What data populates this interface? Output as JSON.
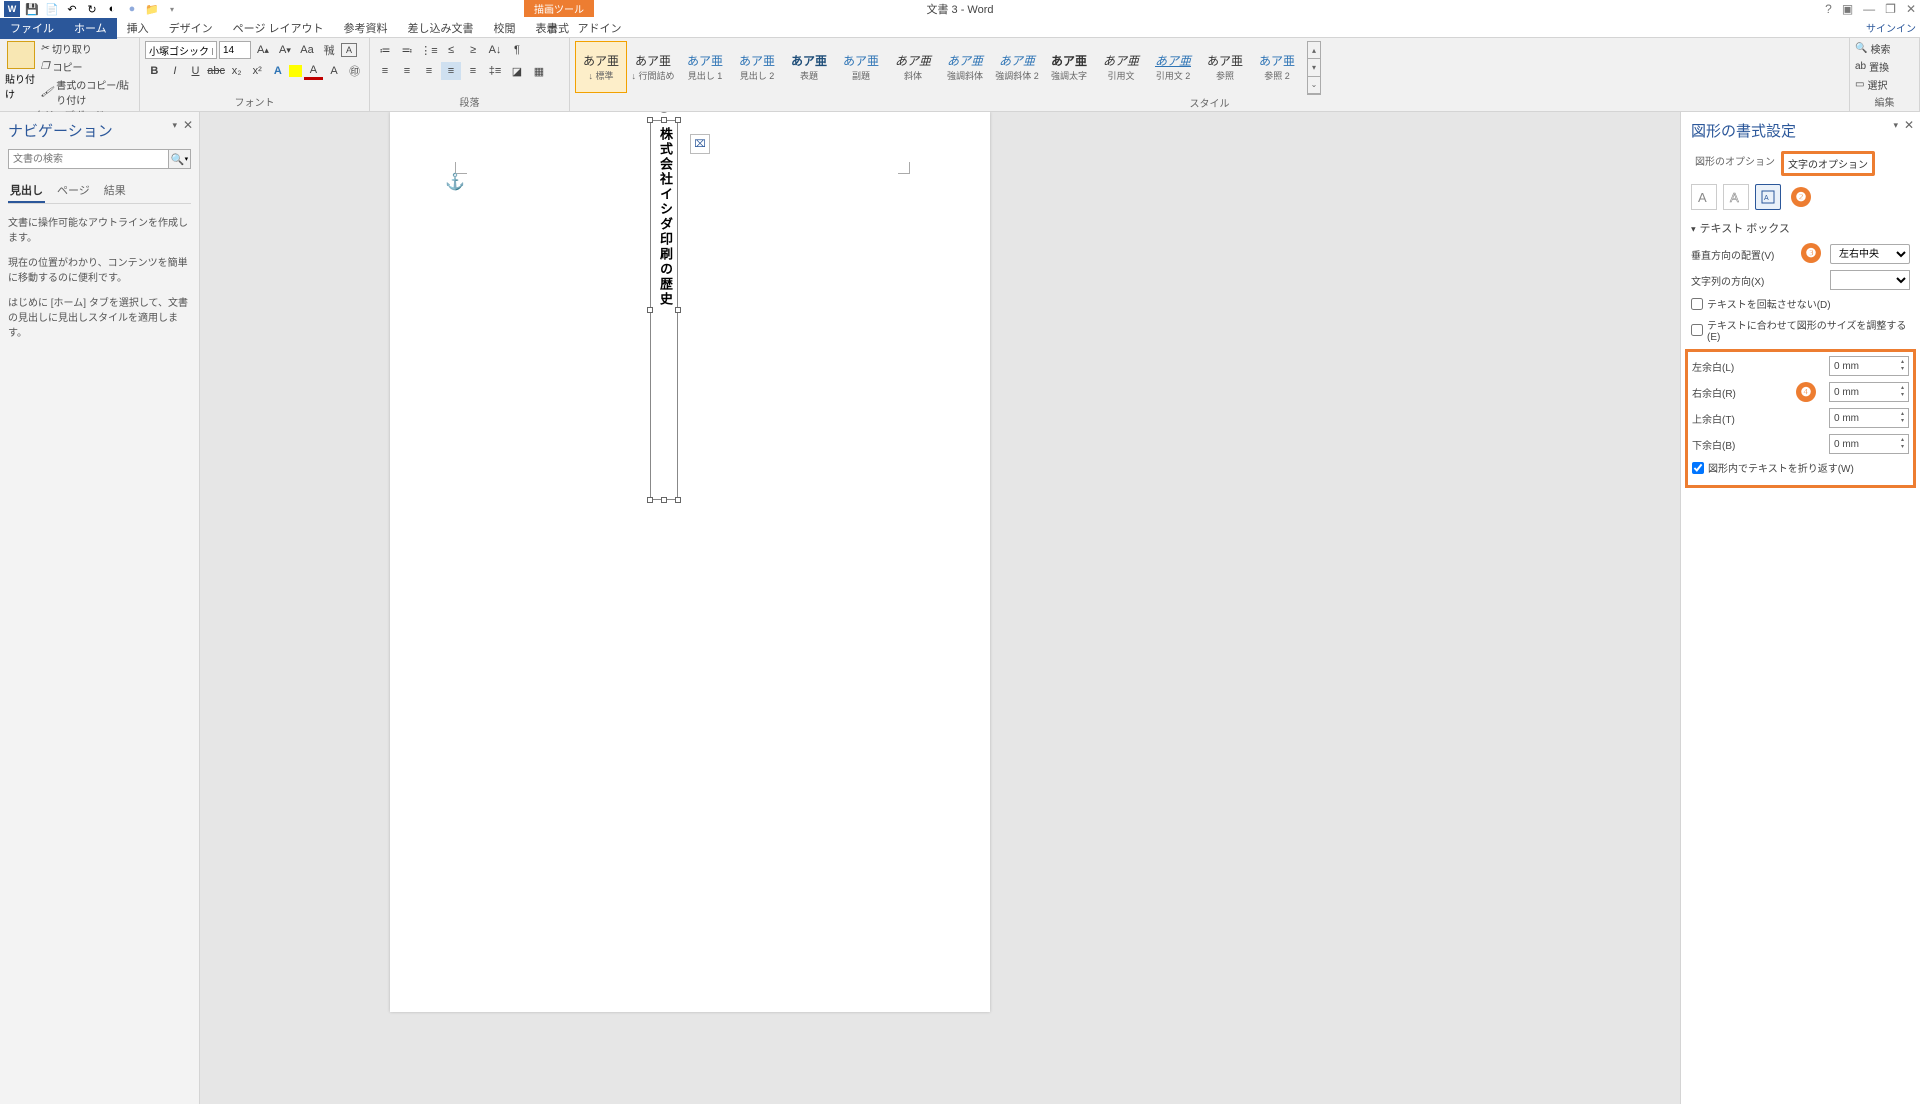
{
  "app": {
    "title": "文書 3 - Word",
    "context_tool": "描画ツール",
    "signin": "サインイン"
  },
  "qat": {
    "save": "保存",
    "undo": "元に戻す",
    "redo": "やり直し"
  },
  "tabs": {
    "file": "ファイル",
    "home": "ホーム",
    "insert": "挿入",
    "design": "デザイン",
    "layout": "ページ レイアウト",
    "references": "参考資料",
    "mailings": "差し込み文書",
    "review": "校閲",
    "view": "表示",
    "addin": "アドイン",
    "format": "書式"
  },
  "ribbon": {
    "clipboard": {
      "label": "クリップボード",
      "paste": "貼り付け",
      "cut": "切り取り",
      "copy": "コピー",
      "painter": "書式のコピー/貼り付け"
    },
    "font": {
      "label": "フォント",
      "name": "小塚ゴシック Pr",
      "size": "14"
    },
    "paragraph": {
      "label": "段落"
    },
    "styles": {
      "label": "スタイル",
      "items": [
        {
          "preview": "あア亜",
          "name": "↓ 標準",
          "cls": ""
        },
        {
          "preview": "あア亜",
          "name": "↓ 行間詰め",
          "cls": ""
        },
        {
          "preview": "あア亜",
          "name": "見出し 1",
          "cls": "blue"
        },
        {
          "preview": "あア亜",
          "name": "見出し 2",
          "cls": "blue"
        },
        {
          "preview": "あア亜",
          "name": "表題",
          "cls": "boldblue"
        },
        {
          "preview": "あア亜",
          "name": "副題",
          "cls": "blue"
        },
        {
          "preview": "あア亜",
          "name": "斜体",
          "cls": "italic"
        },
        {
          "preview": "あア亜",
          "name": "強調斜体",
          "cls": "italic blue"
        },
        {
          "preview": "あア亜",
          "name": "強調斜体 2",
          "cls": "italic blue"
        },
        {
          "preview": "あア亜",
          "name": "強調太字",
          "cls": "bold"
        },
        {
          "preview": "あア亜",
          "name": "引用文",
          "cls": "italic"
        },
        {
          "preview": "あア亜",
          "name": "引用文 2",
          "cls": "italic blue under"
        },
        {
          "preview": "あア亜",
          "name": "参照",
          "cls": ""
        },
        {
          "preview": "あア亜",
          "name": "参照 2",
          "cls": "blue"
        }
      ]
    },
    "editing": {
      "label": "編集",
      "find": "検索",
      "replace": "置換",
      "select": "選択"
    }
  },
  "nav": {
    "title": "ナビゲーション",
    "search_ph": "文書の検索",
    "tabs": {
      "headings": "見出し",
      "pages": "ページ",
      "results": "結果"
    },
    "help1": "文書に操作可能なアウトラインを作成します。",
    "help2": "現在の位置がわかり、コンテンツを簡単に移動するのに便利です。",
    "help3": "はじめに [ホーム] タブを選択して、文書の見出しに見出しスタイルを適用します。"
  },
  "doc": {
    "textbox_content": "株式会社イシダ印刷の歴史"
  },
  "fmt": {
    "title": "図形の書式設定",
    "opt_shape": "図形のオプション",
    "opt_text": "文字のオプション",
    "section": "テキスト ボックス",
    "valign_label": "垂直方向の配置(V)",
    "valign_value": "左右中央",
    "dir_label": "文字列の方向(X)",
    "rot_label": "テキストを回転させない(D)",
    "fit_label": "テキストに合わせて図形のサイズを調整する(E)",
    "ml": "左余白(L)",
    "mr": "右余白(R)",
    "mt": "上余白(T)",
    "mb": "下余白(B)",
    "margin_val": "0 mm",
    "wrap_label": "図形内でテキストを折り返す(W)"
  },
  "callouts": {
    "n1": "❶",
    "n2": "❷",
    "n3": "❸",
    "n4": "❹"
  }
}
